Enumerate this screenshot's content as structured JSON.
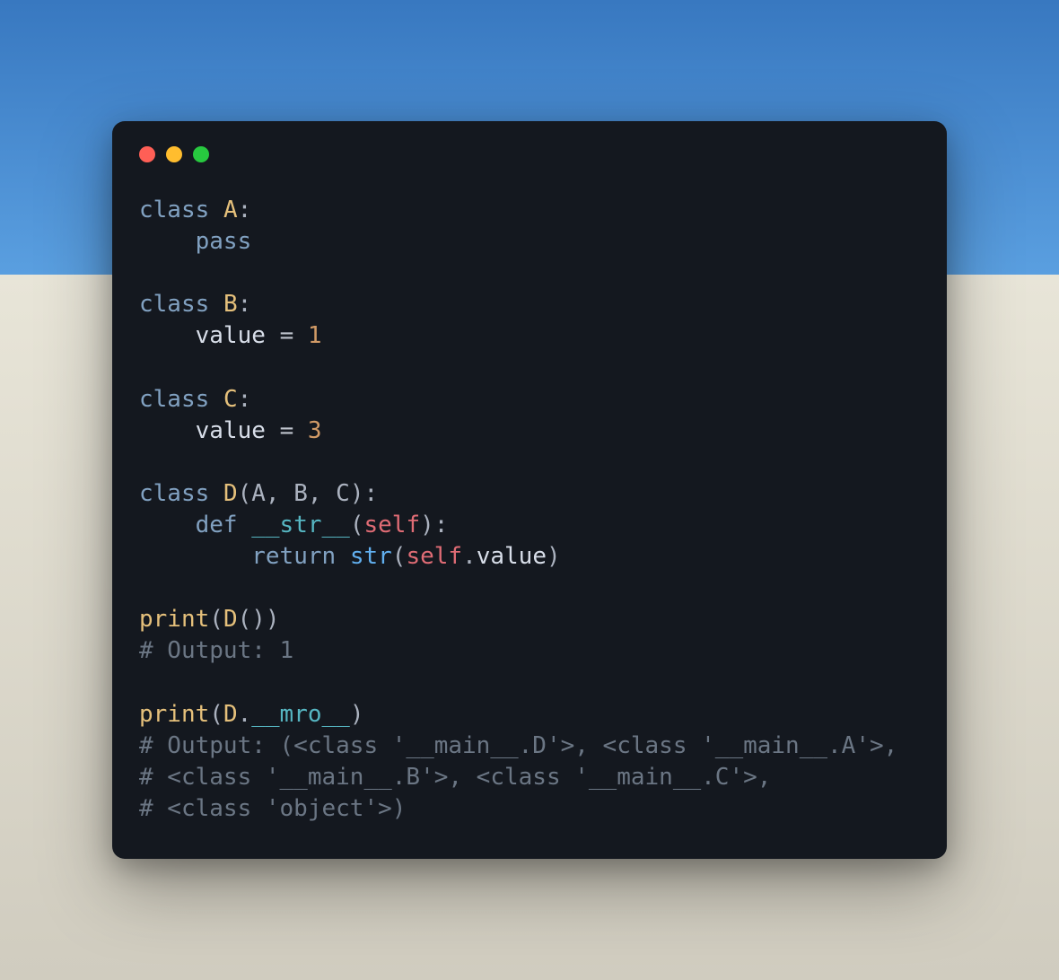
{
  "window": {
    "traffic_lights": [
      "close",
      "minimize",
      "maximize"
    ]
  },
  "code": {
    "class_a_decl": "class",
    "class_a_name": "A",
    "pass_kw": "pass",
    "class_b_decl": "class",
    "class_b_name": "B",
    "value_ident": "value",
    "eq": "=",
    "b_value": "1",
    "class_c_decl": "class",
    "class_c_name": "C",
    "c_value": "3",
    "class_d_decl": "class",
    "class_d_name": "D",
    "d_bases": "(A, B, C)",
    "def_kw": "def",
    "str_method": "__str__",
    "self_kw": "self",
    "return_kw": "return",
    "str_builtin": "str",
    "value_attr": "value",
    "print_fn": "print",
    "d_call": "D",
    "mro_attr": "__mro__",
    "comment_out1": "# Output: 1",
    "comment_out2a": "# Output: (<class '__main__.D'>, <class '__main__.A'>,",
    "comment_out2b": "# <class '__main__.B'>, <class '__main__.C'>,",
    "comment_out2c": "# <class 'object'>)"
  }
}
